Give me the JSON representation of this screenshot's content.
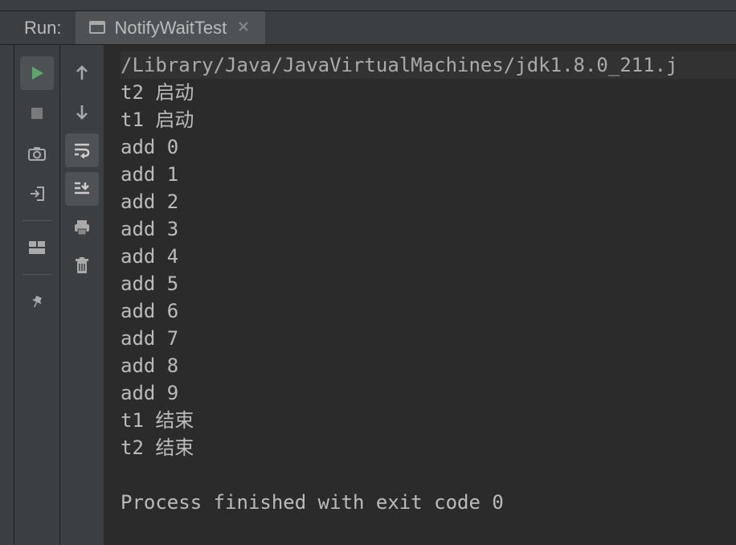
{
  "header": {
    "run_label": "Run:",
    "tab_title": "NotifyWaitTest"
  },
  "console": {
    "command": "/Library/Java/JavaVirtualMachines/jdk1.8.0_211.j",
    "lines": [
      "t2 启动",
      "t1 启动",
      "add 0",
      "add 1",
      "add 2",
      "add 3",
      "add 4",
      "add 5",
      "add 6",
      "add 7",
      "add 8",
      "add 9",
      "t1 结束",
      "t2 结束"
    ],
    "exit_msg": "Process finished with exit code 0"
  }
}
